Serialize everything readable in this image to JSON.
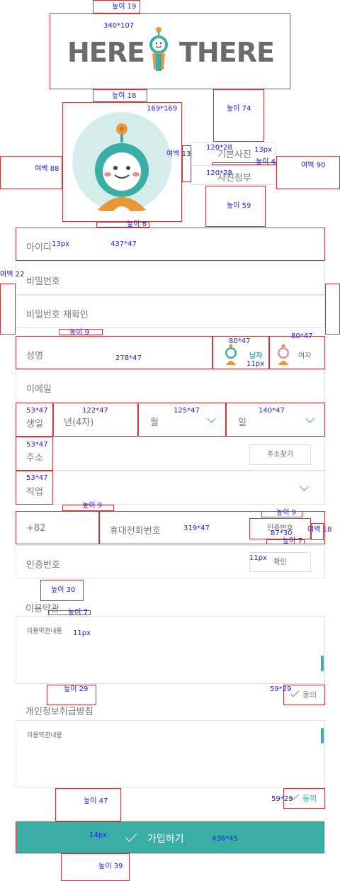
{
  "colors": {
    "accent": "#3aaea5",
    "annotation_border": "#d0353a",
    "annotation_text": "#1d1de0",
    "logo": "#6b6b6b"
  },
  "logo": {
    "left": "HERE",
    "right": "THERE"
  },
  "photo": {
    "default_label": "기본사진",
    "attach_label": "사진첨부"
  },
  "form": {
    "id": "아이디",
    "password": "비밀번호",
    "password_confirm": "비밀번호 재확인",
    "name": "성명",
    "gender_male": "남자",
    "gender_female": "여자",
    "email": "이메일",
    "birth_label": "생일",
    "birth_year": "년(4자)",
    "birth_month": "월",
    "birth_day": "일",
    "address_label": "주소",
    "address_button": "주소찾기",
    "job_label": "직업",
    "country_code": "+82",
    "phone": "휴대전화번호",
    "verify_button": "인증번호",
    "verify_code": "인증번호",
    "confirm_button": "확인"
  },
  "terms": {
    "title": "이용약관",
    "content": "이용약관내용",
    "agree": "동의"
  },
  "privacy": {
    "title": "개인정보취급방침",
    "content": "이용약관내용",
    "agree": "동의"
  },
  "submit": {
    "label": "가입하기"
  },
  "annotations": {
    "a1": "높이 19",
    "a2": "340*107",
    "a3": "높이 18",
    "a4": "169*169",
    "a5": "높이 74",
    "a6": "120*28",
    "a7": "13px",
    "a8": "높이 4",
    "a9": "120*28",
    "a10": "여백 88",
    "a11": "여백 13",
    "a12": "여백 90",
    "a13": "높이 59",
    "a14": "높이 8",
    "a15": "13px",
    "a16": "437*47",
    "a17": "여백 22",
    "a18": "높이 9",
    "a19": "80*47",
    "a20": "80*47",
    "a21": "278*47",
    "a22": "11px",
    "a23": "53*47",
    "a24": "122*47",
    "a25": "125*47",
    "a26": "140*47",
    "a27": "53*47",
    "a28": "53*47",
    "a29": "높이 9",
    "a30": "높이 9",
    "a31": "319*47",
    "a32": "87*30",
    "a33": "여백 18",
    "a34": "높이 7",
    "a35": "11px",
    "a36": "높이 30",
    "a37": "높이 7",
    "a38": "11px",
    "a39": "높이 29",
    "a40": "59*29",
    "a41": "59*29",
    "a42": "높이 47",
    "a43": "14px",
    "a44": "436*45",
    "a45": "높이 39"
  }
}
